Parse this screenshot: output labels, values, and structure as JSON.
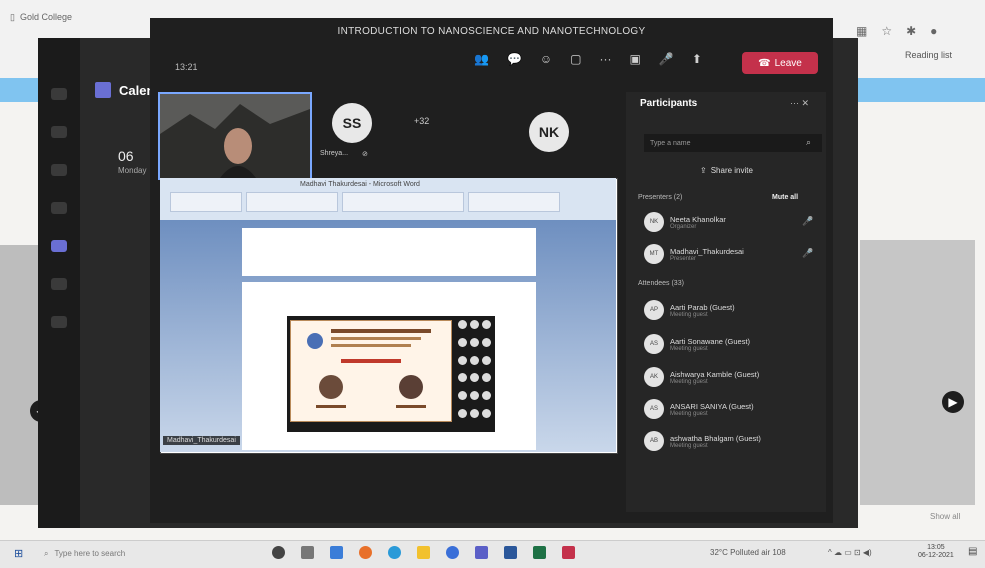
{
  "browser": {
    "tab_title": "Gold College",
    "reading_list": "Reading list",
    "show_all": "Show all"
  },
  "calendar": {
    "title": "Calendar",
    "day": "06",
    "dow": "Monday"
  },
  "meeting": {
    "title": "INTRODUCTION TO NANOSCIENCE AND NANOTECHNOLOGY",
    "timer": "13:21",
    "leave_label": "Leave",
    "tiles": {
      "ss_initials": "SS",
      "ss_name": "Shreya...",
      "more_count": "+32",
      "nk_initials": "NK"
    },
    "shared_screen": {
      "window_title": "Madhavi Thakurdesai - Microsoft Word",
      "presenter_tag": "Madhavi_Thakurdesai"
    }
  },
  "participants": {
    "title": "Participants",
    "search_placeholder": "Type a name",
    "share_invite": "Share invite",
    "presenters_header": "Presenters (2)",
    "mute_all": "Mute all",
    "attendees_header": "Attendees (33)",
    "presenters": [
      {
        "initials": "NK",
        "name": "Neeta Khanolkar",
        "role": "Organizer"
      },
      {
        "initials": "MT",
        "name": "Madhavi_Thakurdesai",
        "role": "Presenter"
      }
    ],
    "attendees": [
      {
        "initials": "AP",
        "name": "Aarti Parab (Guest)",
        "role": "Meeting guest"
      },
      {
        "initials": "AS",
        "name": "Aarti Sonawane (Guest)",
        "role": "Meeting guest"
      },
      {
        "initials": "AK",
        "name": "Aishwarya Kamble (Guest)",
        "role": "Meeting guest"
      },
      {
        "initials": "AS",
        "name": "ANSARI SANIYA (Guest)",
        "role": "Meeting guest"
      },
      {
        "initials": "AB",
        "name": "ashwatha Bhalgam (Guest)",
        "role": "Meeting guest"
      }
    ]
  },
  "taskbar": {
    "search_placeholder": "Type here to search",
    "weather": "32°C Polluted air 108",
    "time": "13:05",
    "date": "06-12-2021"
  },
  "colors": {
    "leave": "#c4314b",
    "teams_bg": "#292929",
    "accent": "#6a6fd4"
  }
}
